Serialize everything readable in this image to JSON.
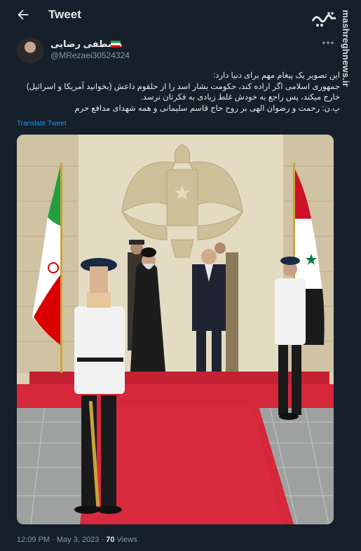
{
  "header": {
    "title": "Tweet",
    "back_icon": "arrow-left-icon"
  },
  "watermark": {
    "logo_text": "مشرق",
    "site": "mashreghnews.ir"
  },
  "author": {
    "display_name": "مصطفی رضایی",
    "handle": "@MRezaei30524324",
    "flag_icon": "iran-flag-icon"
  },
  "tweet": {
    "lines": [
      "این تصویر یک پیغام مهم برای دنیا دارد:",
      "جمهوری اسلامی اگر اراده کند، حکومت بشار اسد را از حلقوم داعش (بخوانید آمریکا و اسرائیل)",
      "خارج میکند، پس راجع به خودش غلط زیادی به فکرتان نرسد.",
      "پ.ن: رحمت و رضوان الهی بر روح حاج قاسم سلیمانی و همه شهدای مدافع حرم"
    ],
    "translate_label": "Translate Tweet"
  },
  "meta": {
    "time": "12:09 PM",
    "sep1": "·",
    "date": "May 3, 2023",
    "sep2": "·",
    "views_count": "70",
    "views_label": "Views"
  },
  "colors": {
    "background": "#15202b",
    "link": "#1d9bf0",
    "muted": "#8b98a5",
    "carpet": "#d5283b"
  }
}
